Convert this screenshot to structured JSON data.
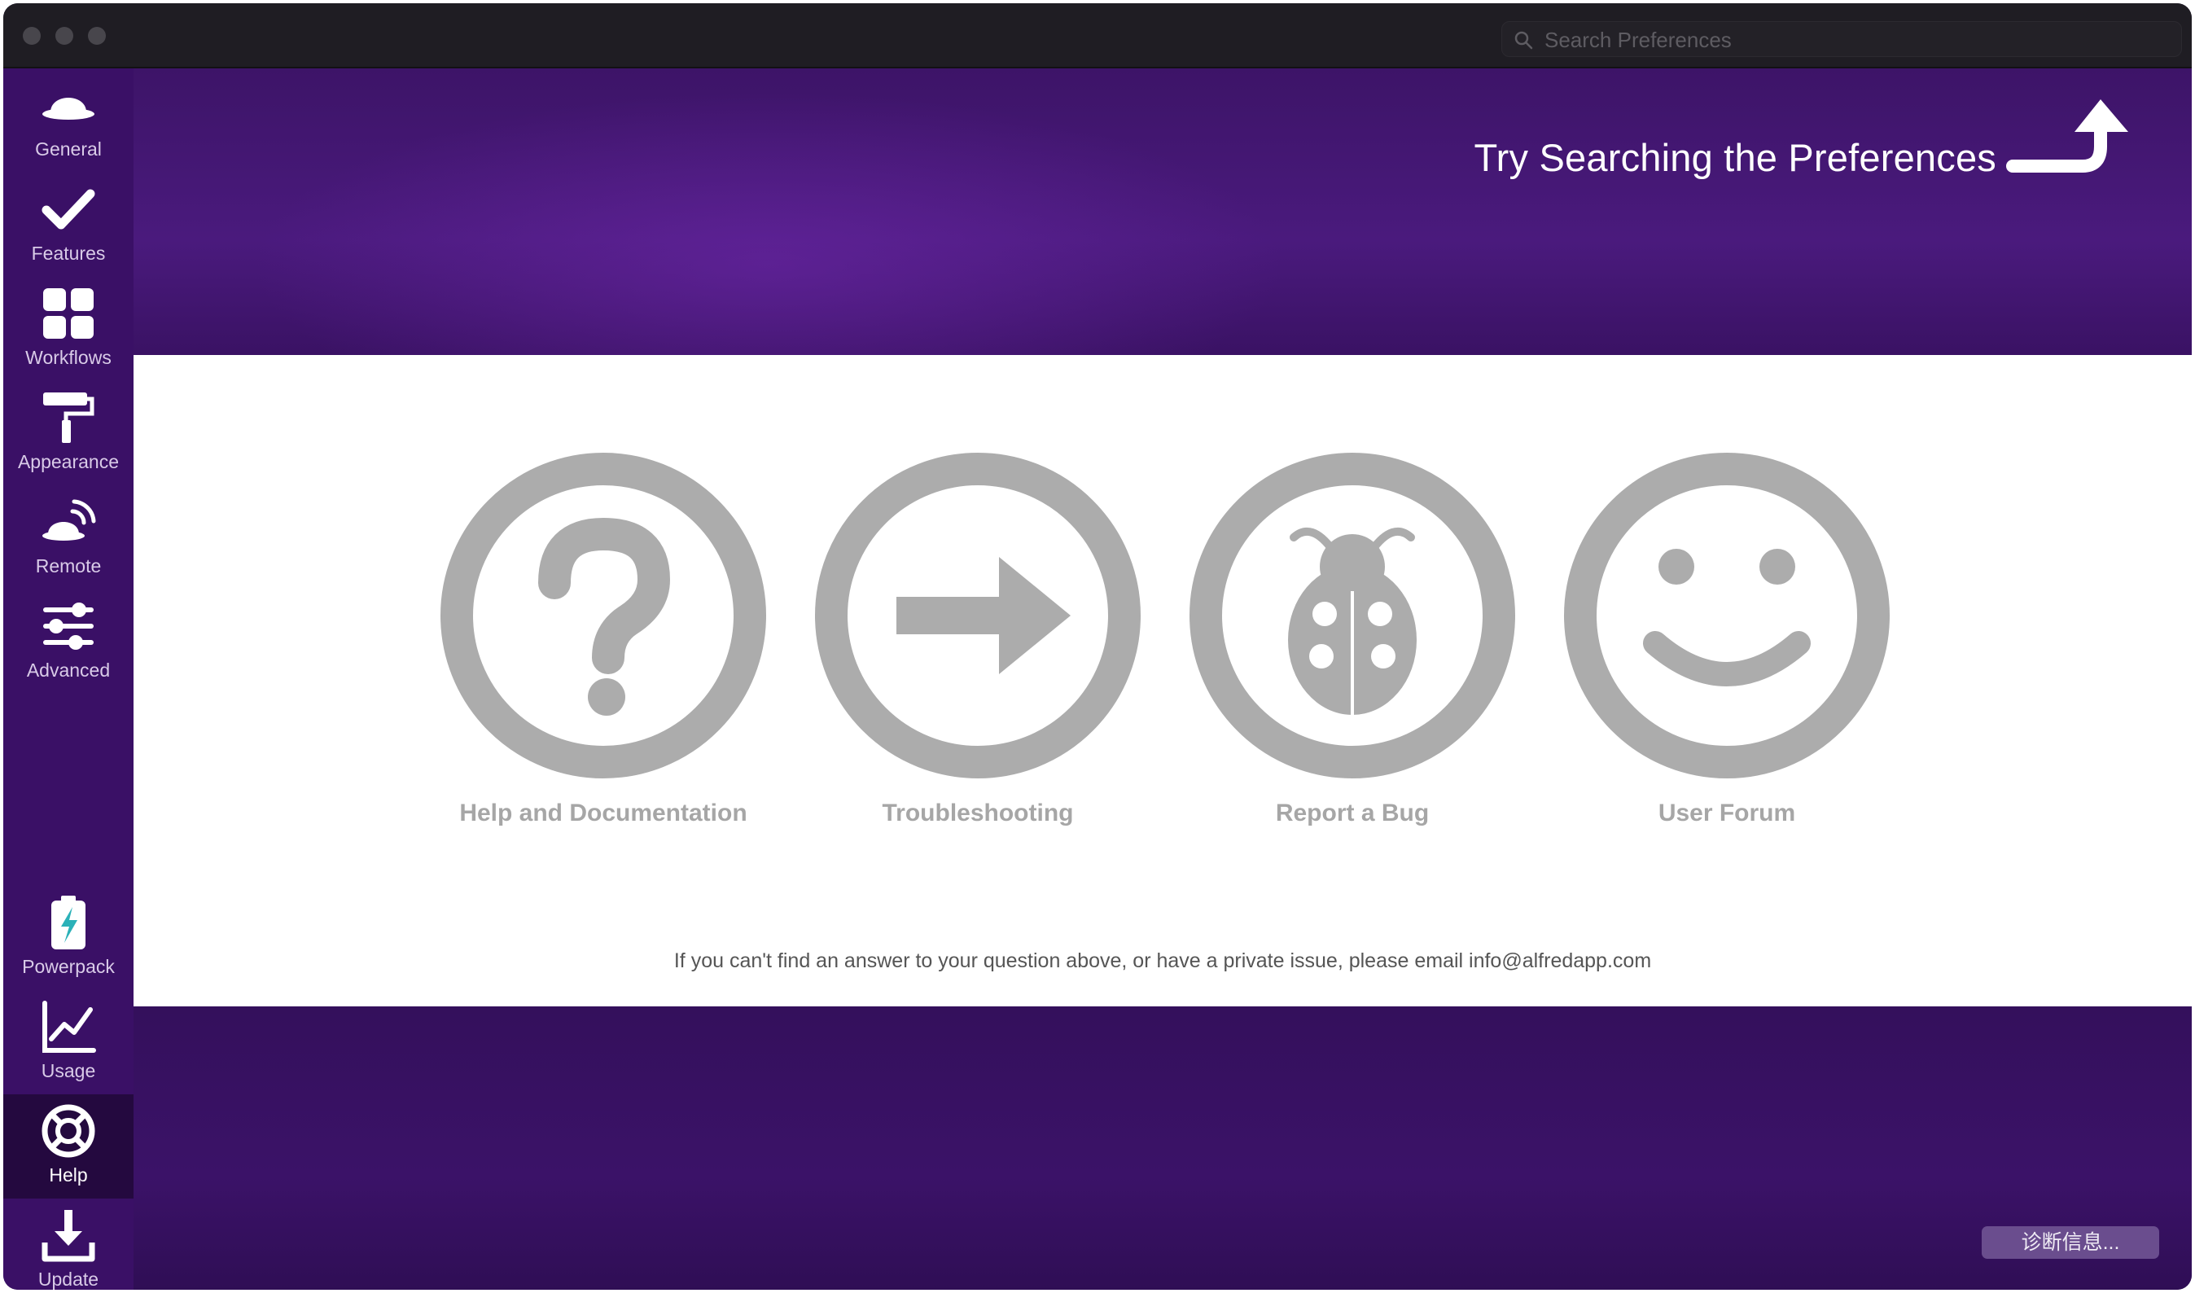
{
  "window": {
    "search_placeholder": "Search Preferences"
  },
  "sidebar": {
    "items": [
      {
        "label": "General",
        "icon": "hat-icon"
      },
      {
        "label": "Features",
        "icon": "checkmark-icon"
      },
      {
        "label": "Workflows",
        "icon": "grid-icon"
      },
      {
        "label": "Appearance",
        "icon": "paint-roller-icon"
      },
      {
        "label": "Remote",
        "icon": "remote-hat-icon"
      },
      {
        "label": "Advanced",
        "icon": "sliders-icon"
      },
      {
        "label": "Powerpack",
        "icon": "battery-icon"
      },
      {
        "label": "Usage",
        "icon": "line-chart-icon"
      },
      {
        "label": "Help",
        "icon": "lifebuoy-icon",
        "active": true
      },
      {
        "label": "Update",
        "icon": "download-icon"
      }
    ]
  },
  "hero": {
    "text": "Try Searching the Preferences"
  },
  "help": {
    "cards": [
      {
        "label": "Help and Documentation",
        "icon": "question-icon"
      },
      {
        "label": "Troubleshooting",
        "icon": "arrow-right-icon"
      },
      {
        "label": "Report a Bug",
        "icon": "ladybug-icon"
      },
      {
        "label": "User Forum",
        "icon": "smiley-icon"
      }
    ],
    "footnote": "If you can't find an answer to your question above, or have a private issue, please email info@alfredapp.com"
  },
  "diagnostics_button": "诊断信息..."
}
